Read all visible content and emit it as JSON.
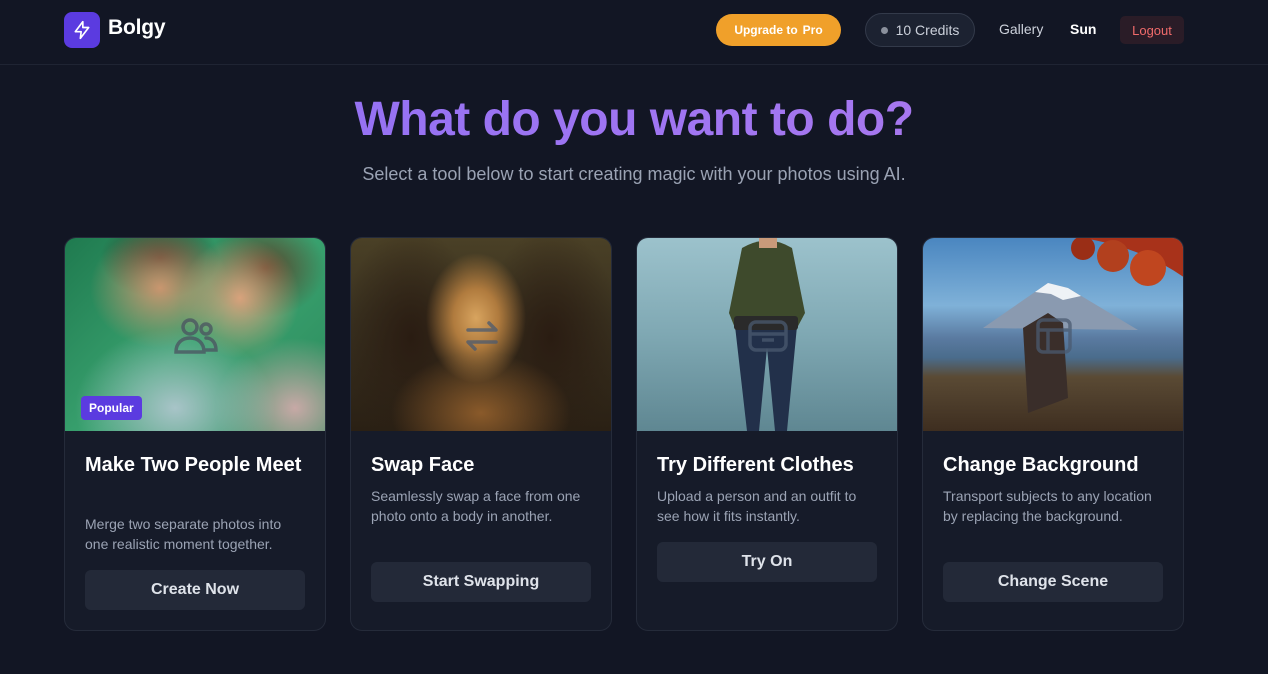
{
  "header": {
    "brand": "Bolgy",
    "upgrade_prefix": "Upgrade to",
    "upgrade_plan": "Pro",
    "credits": "10 Credits",
    "nav_gallery": "Gallery",
    "user_name": "Sun",
    "logout": "Logout"
  },
  "hero": {
    "title": "What do you want to do?",
    "subtitle": "Select a tool below to start creating magic with your photos using AI."
  },
  "cards": [
    {
      "badge": "Popular",
      "title": "Make Two People Meet",
      "description": "Merge two separate photos into one realistic moment together.",
      "button": "Create Now",
      "icon": "users-icon"
    },
    {
      "title": "Swap Face",
      "description": "Seamlessly swap a face from one photo onto a body in another.",
      "button": "Start Swapping",
      "icon": "swap-arrows-icon"
    },
    {
      "title": "Try Different Clothes",
      "description": "Upload a person and an outfit to see how it fits instantly.",
      "button": "Try On",
      "icon": "wardrobe-icon"
    },
    {
      "title": "Change Background",
      "description": "Transport subjects to any location by replacing the background.",
      "button": "Change Scene",
      "icon": "frame-icon"
    }
  ],
  "colors": {
    "background": "#121624",
    "brand": "#5b3be0",
    "upgrade": "#f0a02a",
    "logout_text": "#f06b6b",
    "title_gradient_start": "#8b6ef5",
    "title_gradient_end": "#b07ae8"
  }
}
